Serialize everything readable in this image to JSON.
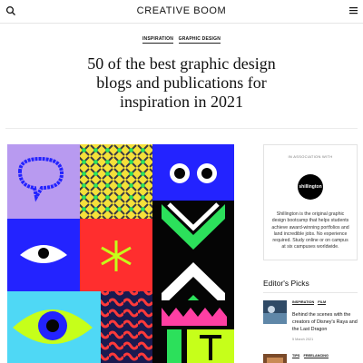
{
  "header": {
    "brand": "CREATIVE BOOM",
    "search_icon": "search-icon",
    "menu_icon": "hamburger-menu-icon"
  },
  "article": {
    "tags": [
      "INSPIRATION",
      "GRAPHIC DESIGN"
    ],
    "headline_lines": [
      "50 of the best graphic design",
      "blogs and publications for",
      "inspiration in 2021"
    ]
  },
  "sidebar": {
    "ad": {
      "label": "IN ASSOCIATION WITH",
      "logo_text": "shillington",
      "text": "Shillington is the original graphic design bootcamp that helps students achieve award-winning portfolios and land incredible jobs. No experience required. Study online or on campus at six campuses worldwide."
    },
    "editors_picks": {
      "title": "Editor's Picks",
      "items": [
        {
          "tags": [
            "INSPIRATION",
            "FILM"
          ],
          "title": "Behind the scenes with the creators of Disney's Raya and the Last Dragon",
          "date": "5 March 2021"
        },
        {
          "tags": [
            "TIPS",
            "FREELANCING"
          ],
          "title": "",
          "date": ""
        }
      ]
    }
  },
  "colors": {
    "purple": "#b89af0",
    "yellow": "#f5e03a",
    "blue": "#2323ff",
    "red": "#ff2e2e",
    "green": "#2ce05b",
    "cyan": "#4fd8f5",
    "black": "#050505",
    "pink": "#ff3fa3",
    "lime": "#c6ff1a"
  }
}
